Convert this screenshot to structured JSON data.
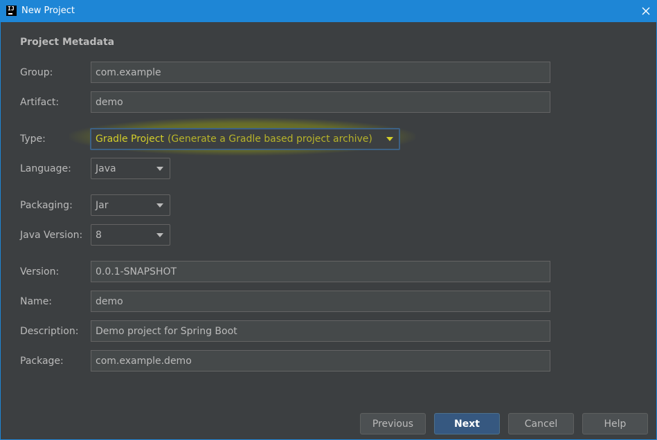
{
  "window": {
    "title": "New Project",
    "app_icon_text": "IJ"
  },
  "section": {
    "title": "Project Metadata"
  },
  "fields": {
    "group": {
      "label": "Group:",
      "value": "com.example"
    },
    "artifact": {
      "label": "Artifact:",
      "value": "demo"
    },
    "type": {
      "label": "Type:",
      "value": "Gradle Project",
      "hint": "(Generate a Gradle based project archive)"
    },
    "language": {
      "label": "Language:",
      "value": "Java"
    },
    "packaging": {
      "label": "Packaging:",
      "value": "Jar"
    },
    "java_version": {
      "label": "Java Version:",
      "value": "8"
    },
    "version": {
      "label": "Version:",
      "value": "0.0.1-SNAPSHOT"
    },
    "name": {
      "label": "Name:",
      "value": "demo"
    },
    "description": {
      "label": "Description:",
      "value": "Demo project for Spring Boot"
    },
    "package": {
      "label": "Package:",
      "value": "com.example.demo"
    }
  },
  "buttons": {
    "previous": "Previous",
    "next": "Next",
    "cancel": "Cancel",
    "help": "Help"
  },
  "colors": {
    "titlebar": "#1e86d6",
    "background": "#3c3f41",
    "field_bg": "#45494a",
    "primary_button": "#365880",
    "highlight": "#b0ba00"
  },
  "icons": {
    "close": "close-icon",
    "dropdown": "chevron-down-icon"
  }
}
